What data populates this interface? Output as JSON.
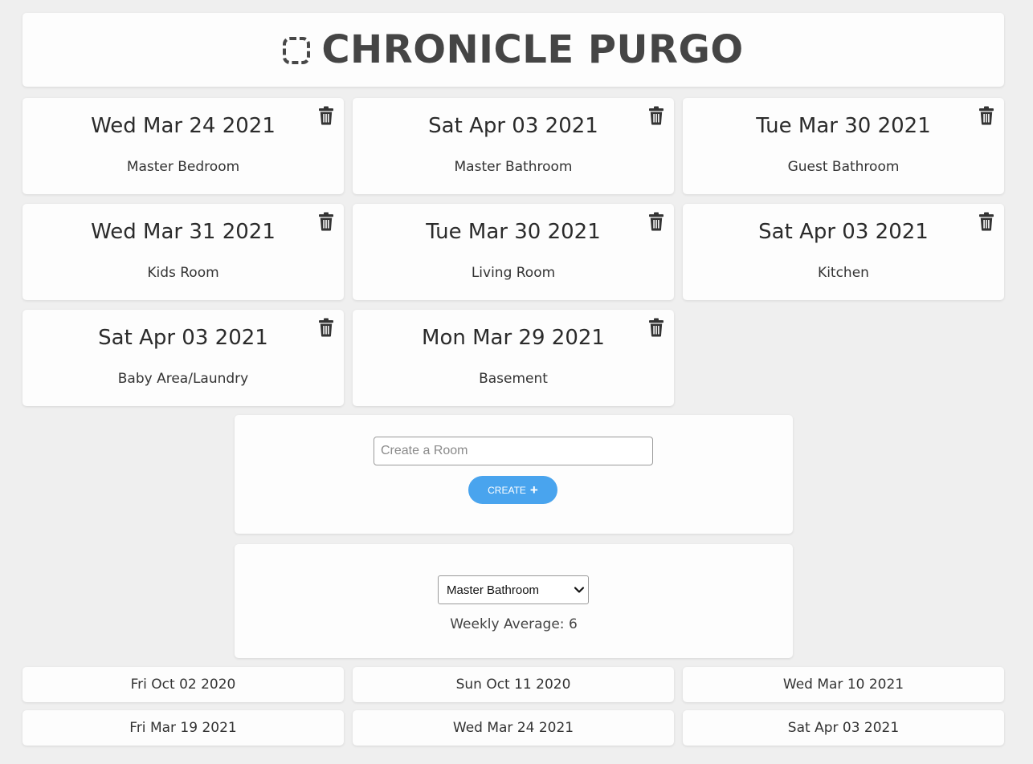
{
  "header": {
    "title": "CHRONICLE PURGO",
    "logo_icon": "dashed-square-icon"
  },
  "rooms": [
    {
      "date": "Wed Mar 24 2021",
      "name": "Master Bedroom"
    },
    {
      "date": "Sat Apr 03 2021",
      "name": "Master Bathroom"
    },
    {
      "date": "Tue Mar 30 2021",
      "name": "Guest Bathroom"
    },
    {
      "date": "Wed Mar 31 2021",
      "name": "Kids Room"
    },
    {
      "date": "Tue Mar 30 2021",
      "name": "Living Room"
    },
    {
      "date": "Sat Apr 03 2021",
      "name": "Kitchen"
    },
    {
      "date": "Sat Apr 03 2021",
      "name": "Baby Area/Laundry"
    },
    {
      "date": "Mon Mar 29 2021",
      "name": "Basement"
    }
  ],
  "create": {
    "placeholder": "Create a Room",
    "button_label": "CREATE",
    "button_icon": "plus-icon",
    "button_color": "#49a4ee"
  },
  "stats": {
    "selected_room": "Master Bathroom",
    "weekly_average": "Weekly Average: 6"
  },
  "history": [
    "Fri Oct 02 2020",
    "Sun Oct 11 2020",
    "Wed Mar 10 2021",
    "Fri Mar 19 2021",
    "Wed Mar 24 2021",
    "Sat Apr 03 2021"
  ],
  "colors": {
    "background": "#efefef",
    "card": "#fdfdfd",
    "text": "#333333"
  }
}
